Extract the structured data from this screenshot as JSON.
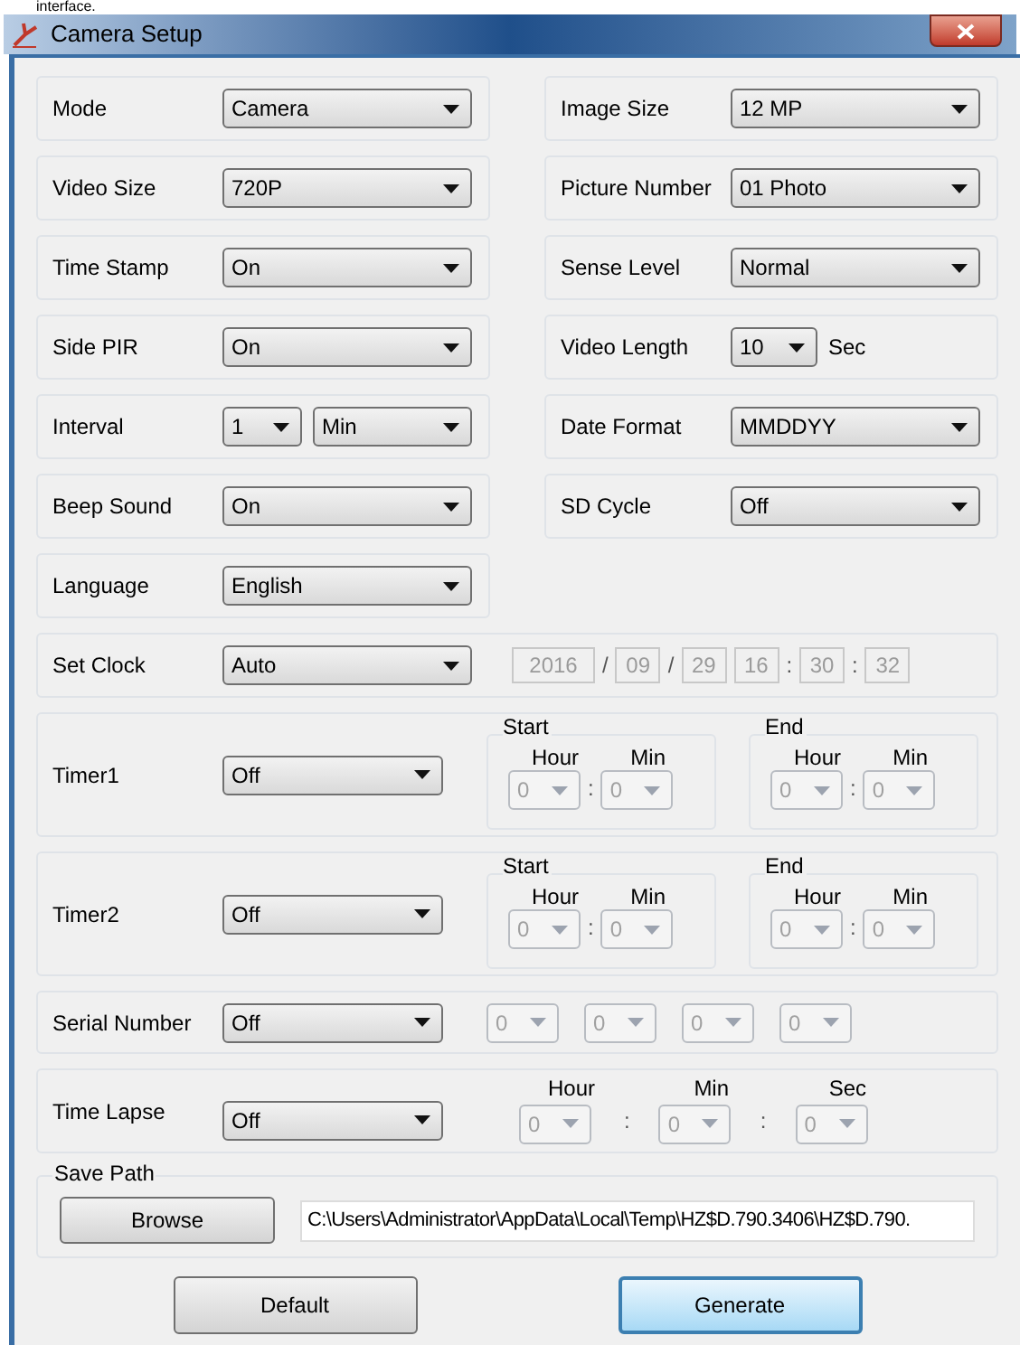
{
  "caption": "interface.",
  "window": {
    "title": "Camera Setup"
  },
  "settings": [
    {
      "label": "Mode",
      "controls": [
        {
          "value": "Camera",
          "disabled": false
        }
      ]
    },
    {
      "label": "Image Size",
      "controls": [
        {
          "value": "12 MP",
          "disabled": false
        }
      ]
    },
    {
      "label": "Video Size",
      "controls": [
        {
          "value": "720P",
          "disabled": false
        }
      ]
    },
    {
      "label": "Picture Number",
      "controls": [
        {
          "value": "01 Photo",
          "disabled": false
        }
      ]
    },
    {
      "label": "Time Stamp",
      "controls": [
        {
          "value": "On",
          "disabled": false
        }
      ]
    },
    {
      "label": "Sense Level",
      "controls": [
        {
          "value": "Normal",
          "disabled": false
        }
      ]
    },
    {
      "label": "Side PIR",
      "controls": [
        {
          "value": "On",
          "disabled": false
        }
      ]
    },
    {
      "label": "Video Length",
      "controls": [
        {
          "value": "10",
          "disabled": false
        }
      ],
      "unit": "Sec"
    },
    {
      "label": "Interval",
      "controls": [
        {
          "value": "1",
          "disabled": false
        },
        {
          "value": "Min",
          "disabled": false
        }
      ]
    },
    {
      "label": "Date Format",
      "controls": [
        {
          "value": "MMDDYY",
          "disabled": false
        }
      ]
    },
    {
      "label": "Beep Sound",
      "controls": [
        {
          "value": "On",
          "disabled": false
        }
      ]
    },
    {
      "label": "SD Cycle",
      "controls": [
        {
          "value": "Off",
          "disabled": false
        }
      ]
    },
    {
      "label": "Language",
      "controls": [
        {
          "value": "English",
          "disabled": false
        }
      ]
    }
  ],
  "set_clock": {
    "label": "Set Clock",
    "mode": {
      "value": "Auto",
      "disabled": false
    },
    "fields": [
      {
        "value": "2016",
        "disabled": true
      },
      {
        "separator": "/",
        "value": "09",
        "disabled": true
      },
      {
        "separator": "/",
        "value": "29",
        "disabled": true
      },
      {
        "value": "16",
        "disabled": true
      },
      {
        "separator": ":",
        "value": "30",
        "disabled": true
      },
      {
        "separator": ":",
        "value": "32",
        "disabled": true
      }
    ]
  },
  "timers": [
    {
      "label": "Timer1",
      "mode": {
        "value": "Off",
        "disabled": false
      },
      "groups": [
        {
          "title": "Start",
          "separator": ":",
          "fields": [
            {
              "label": "Hour",
              "value": "0",
              "disabled": true
            },
            {
              "label": "Min",
              "value": "0",
              "disabled": true
            }
          ]
        },
        {
          "title": "End",
          "separator": ":",
          "fields": [
            {
              "label": "Hour",
              "value": "0",
              "disabled": true
            },
            {
              "label": "Min",
              "value": "0",
              "disabled": true
            }
          ]
        }
      ]
    },
    {
      "label": "Timer2",
      "mode": {
        "value": "Off",
        "disabled": false
      },
      "groups": [
        {
          "title": "Start",
          "separator": ":",
          "fields": [
            {
              "label": "Hour",
              "value": "0",
              "disabled": true
            },
            {
              "label": "Min",
              "value": "0",
              "disabled": true
            }
          ]
        },
        {
          "title": "End",
          "separator": ":",
          "fields": [
            {
              "label": "Hour",
              "value": "0",
              "disabled": true
            },
            {
              "label": "Min",
              "value": "0",
              "disabled": true
            }
          ]
        }
      ]
    }
  ],
  "serial_number": {
    "label": "Serial Number",
    "mode": {
      "value": "Off",
      "disabled": false
    },
    "parts": [
      {
        "value": "0",
        "disabled": true
      },
      {
        "value": "0",
        "disabled": true
      },
      {
        "value": "0",
        "disabled": true
      },
      {
        "value": "0",
        "disabled": true
      }
    ]
  },
  "time_lapse": {
    "label": "Time Lapse",
    "mode": {
      "value": "Off",
      "disabled": false
    },
    "separator": ":",
    "fields": [
      {
        "label": "Hour",
        "value": "0",
        "disabled": true
      },
      {
        "label": "Min",
        "value": "0",
        "disabled": true
      },
      {
        "label": "Sec",
        "value": "0",
        "disabled": true
      }
    ]
  },
  "save_path": {
    "title": "Save Path",
    "button": "Browse",
    "path": "C:\\Users\\Administrator\\AppData\\Local\\Temp\\HZ$D.790.3406\\HZ$D.790."
  },
  "buttons": [
    {
      "label": "Default",
      "default": false
    },
    {
      "label": "Generate",
      "default": true
    }
  ]
}
